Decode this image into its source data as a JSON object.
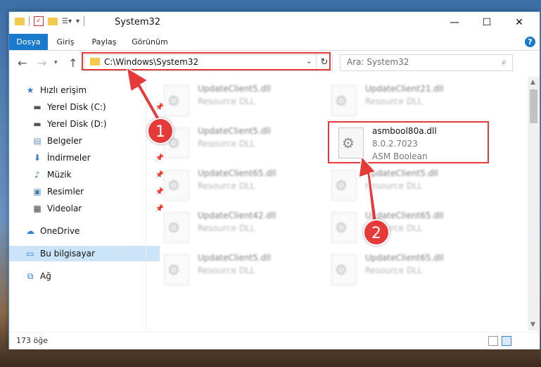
{
  "window": {
    "title": "System32",
    "controls": {
      "minimize": "—",
      "maximize": "☐",
      "close": "✕"
    }
  },
  "ribbon": {
    "tabs": [
      "Dosya",
      "Giriş",
      "Paylaş",
      "Görünüm"
    ],
    "help": "?"
  },
  "address_bar": {
    "path": "C:\\Windows\\System32"
  },
  "search": {
    "placeholder": "Ara: System32"
  },
  "sidebar": {
    "items": [
      {
        "label": "Hızlı erişim",
        "icon": "star-icon",
        "pinned": false
      },
      {
        "label": "Yerel Disk (C:)",
        "icon": "drive-icon",
        "pinned": true
      },
      {
        "label": "Yerel Disk (D:)",
        "icon": "drive-icon",
        "pinned": true
      },
      {
        "label": "Belgeler",
        "icon": "documents-icon",
        "pinned": true
      },
      {
        "label": "İndirmeler",
        "icon": "download-icon",
        "pinned": true
      },
      {
        "label": "Müzik",
        "icon": "music-icon",
        "pinned": true
      },
      {
        "label": "Resimler",
        "icon": "pictures-icon",
        "pinned": true
      },
      {
        "label": "Videolar",
        "icon": "video-icon",
        "pinned": true
      },
      {
        "label": "OneDrive",
        "icon": "cloud-icon",
        "pinned": false
      },
      {
        "label": "Bu bilgisayar",
        "icon": "computer-icon",
        "pinned": false,
        "selected": true
      },
      {
        "label": "Ağ",
        "icon": "network-icon",
        "pinned": false
      }
    ]
  },
  "files": [
    {
      "name": "UpdateClient5.dll",
      "desc": "Resource DLL",
      "blurred": true
    },
    {
      "name": "UpdateClient21.dll",
      "desc": "Resource DLL",
      "blurred": true
    },
    {
      "name": "UpdateClient5.dll",
      "desc": "Resource DLL",
      "blurred": true
    },
    {
      "name": "asmbool80a.dll",
      "version": "8.0.2.7023",
      "desc": "ASM Boolean",
      "blurred": false
    },
    {
      "name": "UpdateClient65.dll",
      "desc": "Resource DLL",
      "blurred": true
    },
    {
      "name": "UpdateClient5.dll",
      "desc": "Resource DLL",
      "blurred": true
    },
    {
      "name": "UpdateClient42.dll",
      "desc": "Resource DLL",
      "blurred": true
    },
    {
      "name": "UpdateClient65.dll",
      "desc": "Resource DLL",
      "blurred": true
    },
    {
      "name": "UpdateClient5.dll",
      "desc": "Resource DLL",
      "blurred": true
    },
    {
      "name": "UpdateClient65.dll",
      "desc": "Resource DLL",
      "blurred": true
    }
  ],
  "status": {
    "item_count": "173 öğe"
  },
  "annotations": {
    "badge_1": "1",
    "badge_2": "2",
    "color": "#e63a3a"
  },
  "colors": {
    "accent": "#1979ca",
    "highlight": "#e63a3a",
    "selected": "#cce4f7"
  }
}
